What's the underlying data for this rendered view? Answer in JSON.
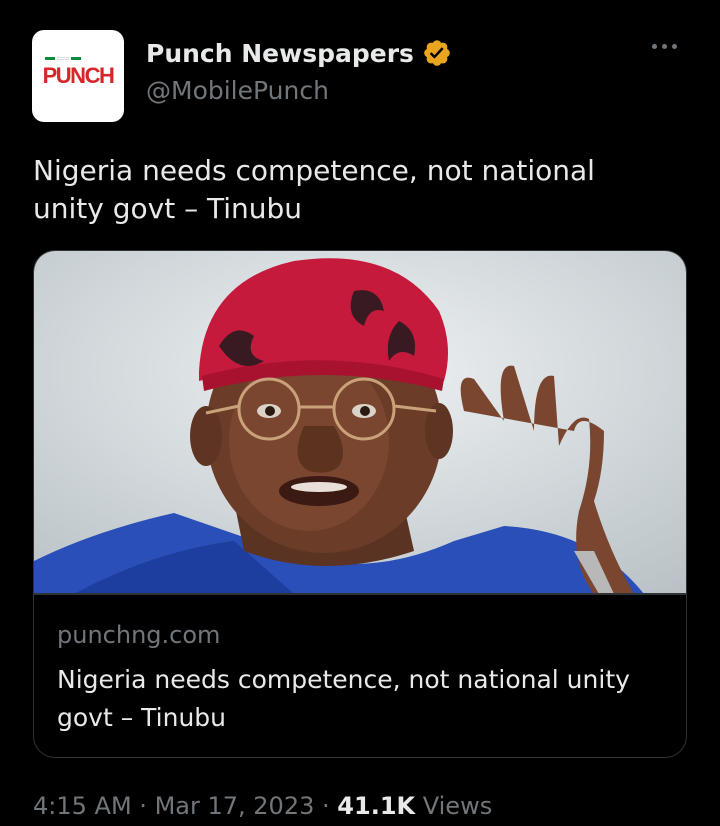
{
  "author": {
    "avatar_text": "PUNCH",
    "display_name": "Punch Newspapers",
    "handle": "@MobilePunch",
    "verified_icon": "verified-badge-icon",
    "verified_color": "#f4b400"
  },
  "tweet": {
    "text": "Nigeria needs competence, not national unity govt – Tinubu"
  },
  "link_card": {
    "domain": "punchng.com",
    "title": "Nigeria needs competence, not national unity govt – Tinubu",
    "image_description_icon": "photo-of-man-in-red-cap-icon"
  },
  "meta": {
    "time": "4:15 AM",
    "separator": "·",
    "date": "Mar 17, 2023",
    "views_count": "41.1K",
    "views_label": "Views"
  },
  "colors": {
    "background": "#000000",
    "primary_text": "#e7e9ea",
    "secondary_text": "#71767b",
    "border": "#2f3336",
    "brand_red": "#d7262b"
  }
}
